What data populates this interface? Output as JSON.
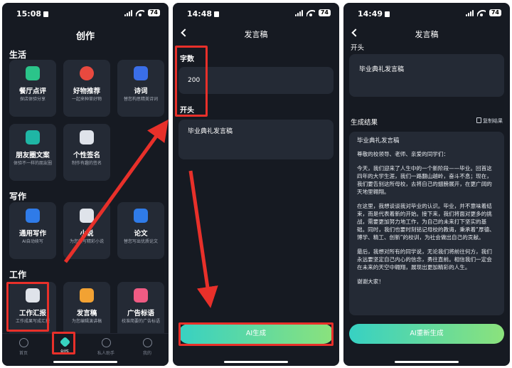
{
  "screens": [
    {
      "status": {
        "time": "15:08",
        "battery": "74"
      },
      "title": "创作",
      "sections": [
        {
          "label": "生活",
          "cards": [
            {
              "title": "餐厅点评",
              "subtitle": "探店体验分享",
              "icon": "food-review-icon",
              "color": "#2bc48a"
            },
            {
              "title": "好物推荐",
              "subtitle": "一起来种草好物",
              "icon": "star-badge-icon",
              "color": "#e8493f"
            },
            {
              "title": "诗词",
              "subtitle": "替您构思精美诗词",
              "icon": "poem-icon",
              "color": "#3a6ee8"
            },
            {
              "title": "朋友圈文案",
              "subtitle": "体验不一样的朋友圈",
              "icon": "moments-icon",
              "color": "#1fb6a5"
            },
            {
              "title": "个性签名",
              "subtitle": "制作有趣的签名",
              "icon": "signature-icon",
              "color": "#dfe3ea"
            }
          ]
        },
        {
          "label": "写作",
          "cards": [
            {
              "title": "通用写作",
              "subtitle": "AI自动续写",
              "icon": "writing-icon",
              "color": "#2f7be8"
            },
            {
              "title": "小说",
              "subtitle": "为您续写精彩小说",
              "icon": "novel-icon",
              "color": "#dfe3ea"
            },
            {
              "title": "论文",
              "subtitle": "替您写出优质论文",
              "icon": "paper-icon",
              "color": "#2f7be8"
            }
          ]
        },
        {
          "label": "工作",
          "cards": [
            {
              "title": "工作汇报",
              "subtitle": "工作成果写成汇报",
              "icon": "report-icon",
              "color": "#dfe3ea"
            },
            {
              "title": "发言稿",
              "subtitle": "为您编辑演讲稿",
              "icon": "speech-icon",
              "color": "#f2a233"
            },
            {
              "title": "广告标语",
              "subtitle": "校准简要的广告标语",
              "icon": "ad-flag-icon",
              "color": "#ef5b83"
            }
          ]
        }
      ],
      "tabs": [
        {
          "label": "首页",
          "icon": "home-icon"
        },
        {
          "label": "创作",
          "icon": "create-icon",
          "active": true
        },
        {
          "label": "私人助手",
          "icon": "assistant-icon"
        },
        {
          "label": "我的",
          "icon": "profile-icon"
        }
      ]
    },
    {
      "status": {
        "time": "14:48",
        "battery": "74"
      },
      "title": "发言稿",
      "word_count_label": "字数",
      "word_count_value": "200",
      "opening_label": "开头",
      "opening_value": "毕业典礼发言稿",
      "generate_button": "AI生成"
    },
    {
      "status": {
        "time": "14:49",
        "battery": "74"
      },
      "title": "发言稿",
      "opening_label": "开头",
      "opening_value": "毕业典礼发言稿",
      "result_label": "生成结果",
      "copy_label": "复制结果",
      "result_paragraphs": [
        "毕业典礼发言稿",
        "尊敬的校领导、老师、亲爱的同学们：",
        "今天，我们迎来了人生中的一个新阶段——毕业。回首这四年的大学生涯，我们一路翻山越岭，奋斗不息；现在，我们要告别这所母校，去将自己的翅膀展开，在更广阔的天地里翱翔。",
        "在这里，我想谈谈我对毕业的认识。毕业，并不意味着结束，而是代表着新的开始。接下来，我们将面对更多的挑战，需要更加努力地工作，为自己的未来打下坚实的基础。同时，我们也要时刻铭记母校的教诲，秉承着“厚德、博学、精工、创新”的校训，为社会做出自己的贡献。",
        "最后，我想对所有的同学说，无论我们将前往何方，我们永远要坚定自己内心的信念，勇往直前。相信我们一定会在未来的天空中翱翔，展现出更加精彩的人生。",
        "谢谢大家！"
      ],
      "regenerate_button": "AI重新生成"
    }
  ]
}
